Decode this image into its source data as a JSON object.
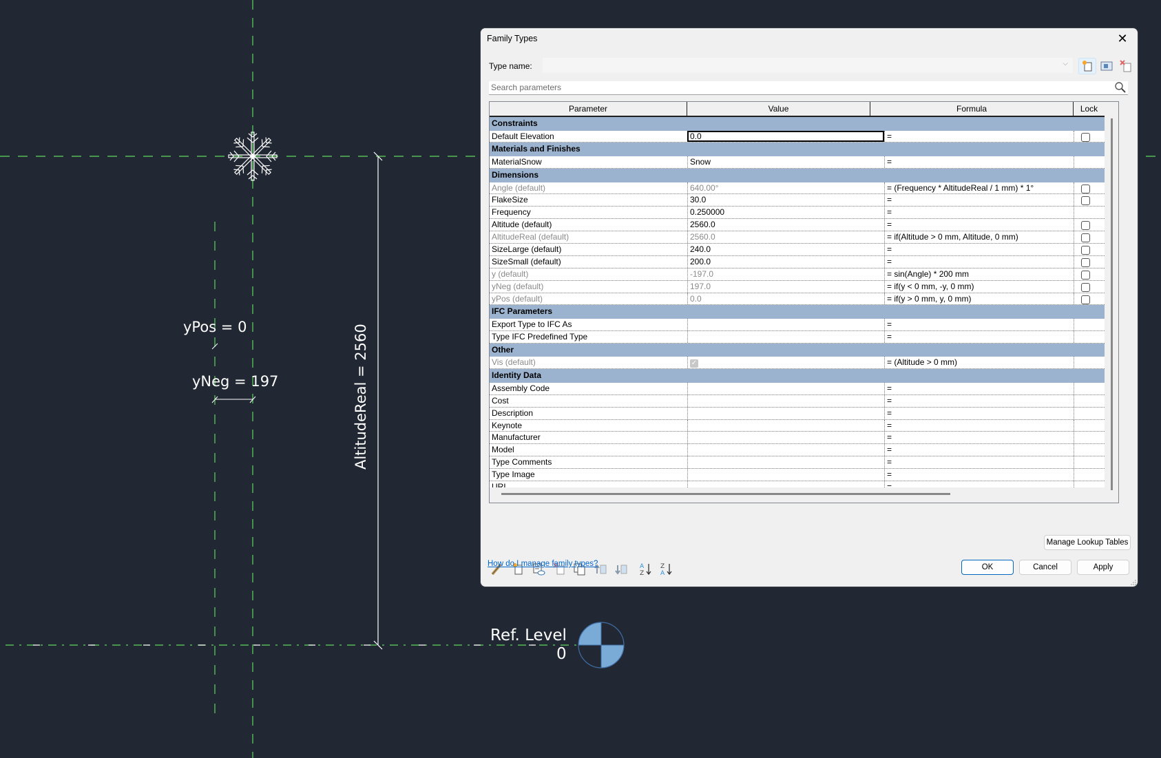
{
  "canvas": {
    "labels": {
      "ypos": "yPos = 0",
      "yneg": "yNeg = 197",
      "altitude_real": "AltitudeReal = 2560",
      "level_name": "Ref. Level",
      "level_elevation": "0"
    },
    "colors": {
      "background": "#222833",
      "ref_plane": "#5fd65f",
      "lines": "#ffffff",
      "level_head": "#7aaad6"
    }
  },
  "dialog": {
    "title": "Family Types",
    "close_icon": "close-icon",
    "type_name_label": "Type name:",
    "type_name_value": "",
    "type_toolbar": [
      "new-type-icon",
      "rename-type-icon",
      "delete-type-icon"
    ],
    "search_placeholder": "Search parameters",
    "columns": [
      "Parameter",
      "Value",
      "Formula",
      "Lock"
    ],
    "groups": [
      {
        "name": "Constraints",
        "rows": [
          {
            "param": "Default Elevation",
            "value": "0.0",
            "formula": "=",
            "lock": true,
            "greyed": false,
            "selected": true
          }
        ]
      },
      {
        "name": "Materials and Finishes",
        "rows": [
          {
            "param": "MaterialSnow",
            "value": "Snow",
            "formula": "=",
            "lock": false,
            "greyed": false
          }
        ]
      },
      {
        "name": "Dimensions",
        "rows": [
          {
            "param": "Angle (default)",
            "value": "640.00°",
            "formula": "= (Frequency * AltitudeReal / 1 mm) * 1°",
            "lock": true,
            "greyed": true
          },
          {
            "param": "FlakeSize",
            "value": "30.0",
            "formula": "=",
            "lock": true,
            "greyed": false
          },
          {
            "param": "Frequency",
            "value": "0.250000",
            "formula": "=",
            "lock": false,
            "greyed": false
          },
          {
            "param": "Altitude (default)",
            "value": "2560.0",
            "formula": "=",
            "lock": true,
            "greyed": false
          },
          {
            "param": "AltitudeReal (default)",
            "value": "2560.0",
            "formula": "= if(Altitude > 0 mm, Altitude, 0 mm)",
            "lock": true,
            "greyed": true
          },
          {
            "param": "SizeLarge (default)",
            "value": "240.0",
            "formula": "=",
            "lock": true,
            "greyed": false
          },
          {
            "param": "SizeSmall (default)",
            "value": "200.0",
            "formula": "=",
            "lock": true,
            "greyed": false
          },
          {
            "param": "y (default)",
            "value": "-197.0",
            "formula": "= sin(Angle) * 200 mm",
            "lock": true,
            "greyed": true
          },
          {
            "param": "yNeg (default)",
            "value": "197.0",
            "formula": "= if(y < 0 mm, -y, 0 mm)",
            "lock": true,
            "greyed": true
          },
          {
            "param": "yPos (default)",
            "value": "0.0",
            "formula": "= if(y > 0 mm, y, 0 mm)",
            "lock": true,
            "greyed": true
          }
        ]
      },
      {
        "name": "IFC Parameters",
        "rows": [
          {
            "param": "Export Type to IFC As",
            "value": "",
            "formula": "=",
            "lock": false,
            "greyed": false
          },
          {
            "param": "Type IFC Predefined Type",
            "value": "",
            "formula": "=",
            "lock": false,
            "greyed": false
          }
        ]
      },
      {
        "name": "Other",
        "rows": [
          {
            "param": "Vis (default)",
            "value": "",
            "checkbox": true,
            "formula": "= (Altitude > 0 mm)",
            "lock": false,
            "greyed": true
          }
        ]
      },
      {
        "name": "Identity Data",
        "rows": [
          {
            "param": "Assembly Code",
            "value": "",
            "formula": "=",
            "lock": false,
            "greyed": false
          },
          {
            "param": "Cost",
            "value": "",
            "formula": "=",
            "lock": false,
            "greyed": false
          },
          {
            "param": "Description",
            "value": "",
            "formula": "=",
            "lock": false,
            "greyed": false
          },
          {
            "param": "Keynote",
            "value": "",
            "formula": "=",
            "lock": false,
            "greyed": false
          },
          {
            "param": "Manufacturer",
            "value": "",
            "formula": "=",
            "lock": false,
            "greyed": false
          },
          {
            "param": "Model",
            "value": "",
            "formula": "=",
            "lock": false,
            "greyed": false
          },
          {
            "param": "Type Comments",
            "value": "",
            "formula": "=",
            "lock": false,
            "greyed": false
          },
          {
            "param": "Type Image",
            "value": "",
            "formula": "=",
            "lock": false,
            "greyed": false
          },
          {
            "param": "URL",
            "value": "",
            "formula": "=",
            "lock": false,
            "greyed": false
          }
        ]
      }
    ],
    "param_toolbar": [
      "edit-parameter-icon",
      "new-parameter-icon",
      "shared-parameter-icon",
      "delete-parameter-icon",
      "copy-parameter-icon",
      "move-up-icon",
      "move-down-icon",
      "sort-ascending-icon",
      "sort-descending-icon"
    ],
    "help_link": "How do I manage family types?",
    "manage_lookup": "Manage Lookup Tables",
    "ok": "OK",
    "cancel": "Cancel",
    "apply": "Apply",
    "colors": {
      "group_header": "#9bb3cf",
      "link": "#0066cc",
      "default_button_border": "#0067c0"
    }
  }
}
